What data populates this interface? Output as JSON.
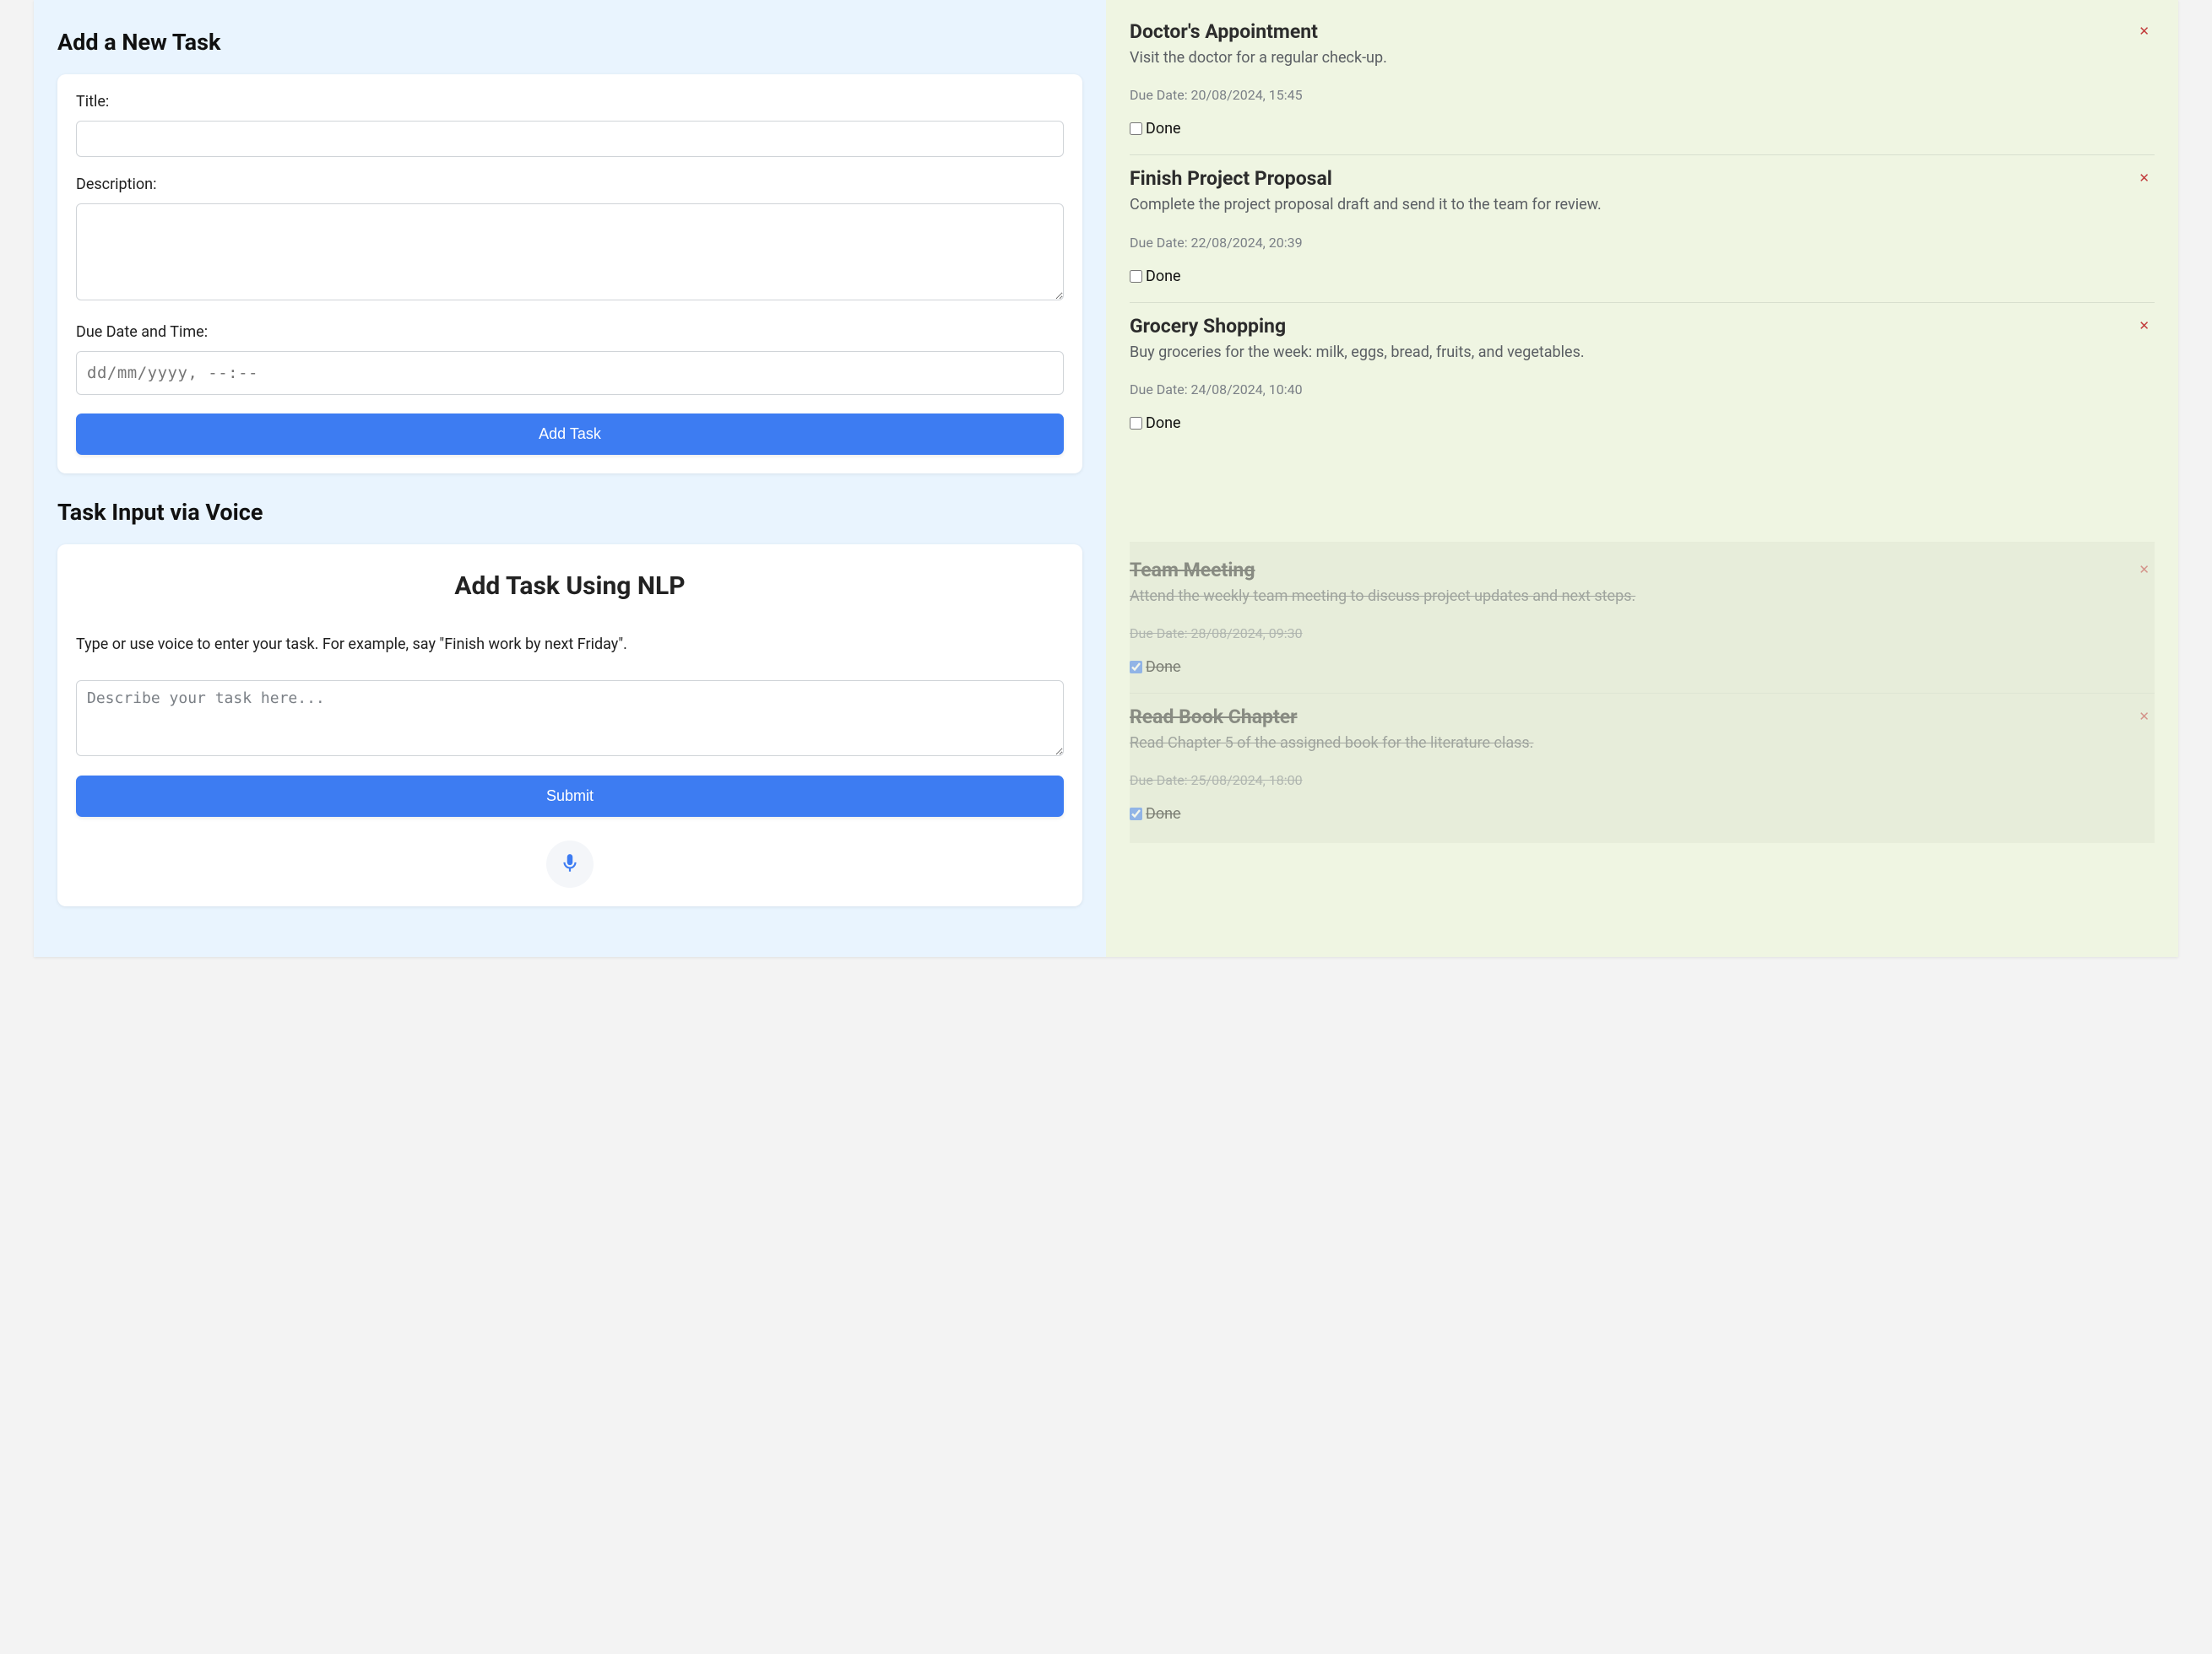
{
  "left": {
    "add_task_heading": "Add a New Task",
    "title_label": "Title:",
    "description_label": "Description:",
    "due_label": "Due Date and Time:",
    "due_placeholder": "dd/mm/yyyy, --:--",
    "add_task_btn": "Add Task",
    "voice_heading": "Task Input via Voice",
    "nlp_title": "Add Task Using NLP",
    "nlp_helper": "Type or use voice to enter your task. For example, say \"Finish work by next Friday\".",
    "nlp_placeholder": "Describe your task here...",
    "submit_btn": "Submit"
  },
  "tasks": {
    "due_prefix": "Due Date: ",
    "done_label": "Done",
    "pending": [
      {
        "title": "Doctor's Appointment",
        "desc": "Visit the doctor for a regular check-up.",
        "due": "20/08/2024, 15:45",
        "done": false
      },
      {
        "title": "Finish Project Proposal",
        "desc": "Complete the project proposal draft and send it to the team for review.",
        "due": "22/08/2024, 20:39",
        "done": false
      },
      {
        "title": "Grocery Shopping",
        "desc": "Buy groceries for the week: milk, eggs, bread, fruits, and vegetables.",
        "due": "24/08/2024, 10:40",
        "done": false
      }
    ],
    "completed": [
      {
        "title": "Team Meeting",
        "desc": "Attend the weekly team meeting to discuss project updates and next steps.",
        "due": "28/08/2024, 09:30",
        "done": true
      },
      {
        "title": "Read Book Chapter",
        "desc": "Read Chapter 5 of the assigned book for the literature class.",
        "due": "25/08/2024, 18:00",
        "done": true
      }
    ]
  }
}
